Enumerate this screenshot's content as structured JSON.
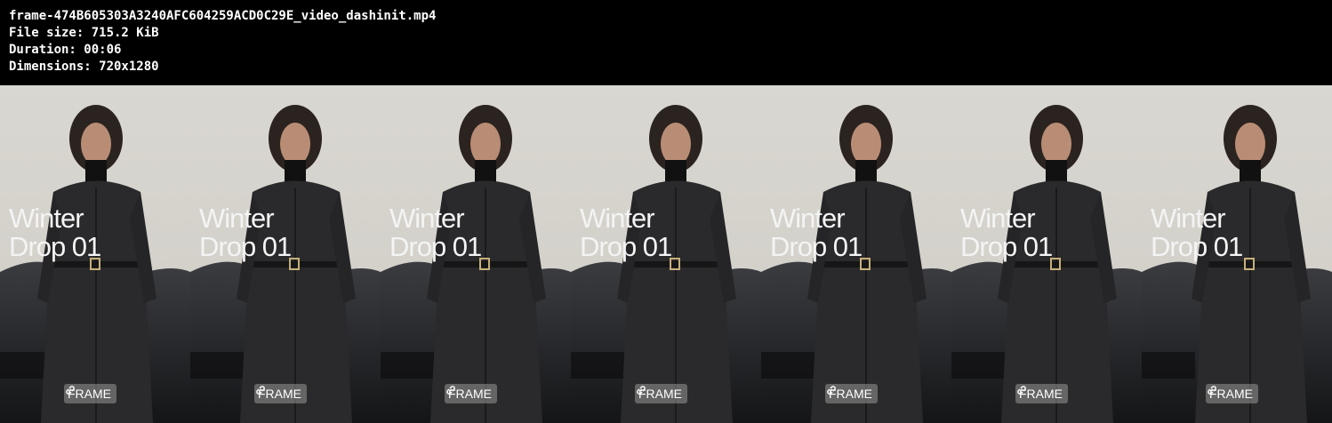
{
  "header": {
    "filename": "frame-474B605303A3240AFC604259ACD0C29E_video_dashinit.mp4",
    "file_size": "File size: 715.2 KiB",
    "duration": "Duration: 00:06",
    "dimensions": "Dimensions: 720x1280"
  },
  "frames": [
    {
      "line1": "Winter",
      "line2": "Drop 01",
      "badge": "FRAME"
    },
    {
      "line1": "Winter",
      "line2": "Drop 01",
      "badge": "FRAME"
    },
    {
      "line1": "Winter",
      "line2": "Drop 01",
      "badge": "FRAME"
    },
    {
      "line1": "Winter",
      "line2": "Drop 01",
      "badge": "FRAME"
    },
    {
      "line1": "Winter",
      "line2": "Drop 01",
      "badge": "FRAME"
    },
    {
      "line1": "Winter",
      "line2": "Drop 01",
      "badge": "FRAME"
    },
    {
      "line1": "Winter",
      "line2": "Drop 01",
      "badge": "FRAME"
    }
  ],
  "colors": {
    "background": "#000000",
    "wall": "#d7d4cd",
    "coat": "#2a2a2c",
    "car": "#1c1d20",
    "text": "#ffffff"
  }
}
